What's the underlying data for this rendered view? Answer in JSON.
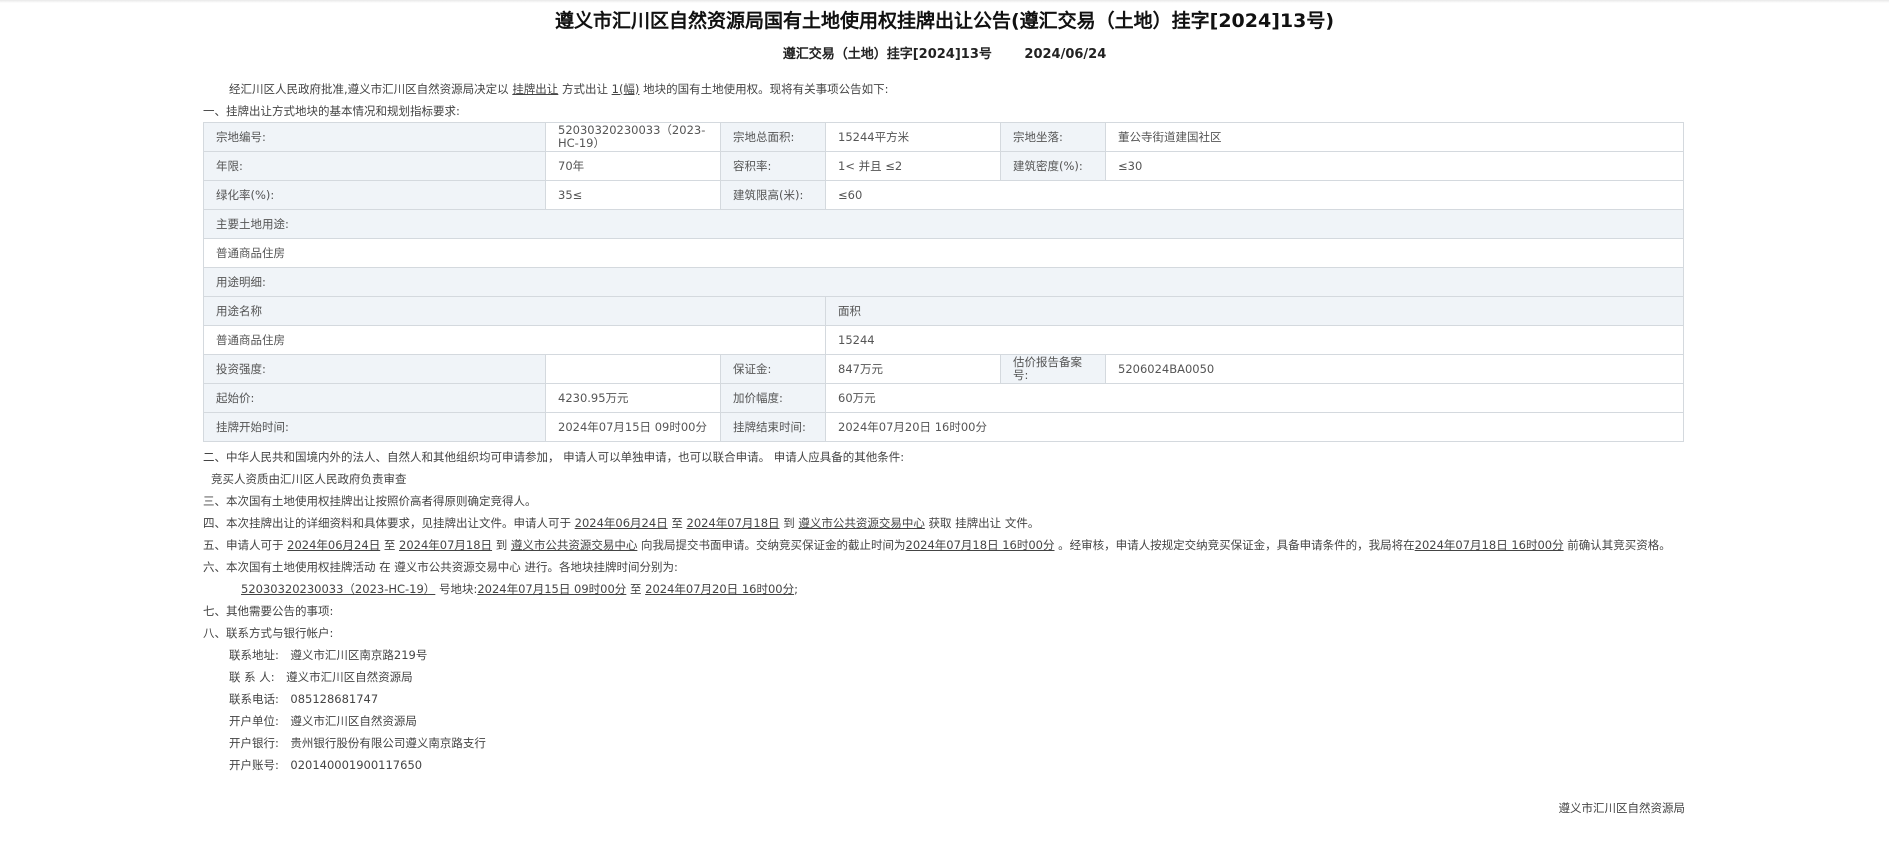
{
  "header": {
    "title": "遵义市汇川区自然资源局国有土地使用权挂牌出让公告(遵汇交易（土地）挂字[2024]13号)",
    "doc_no": "遵汇交易（土地）挂字[2024]13号",
    "date": "2024/06/24"
  },
  "intro": {
    "prefix": "经汇川区人民政府批准,遵义市汇川区自然资源局决定以",
    "method": "挂牌出让",
    "mid": "方式出让",
    "count": "1(幅)",
    "suffix": "地块的国有土地使用权。现将有关事项公告如下:"
  },
  "section1": "一、挂牌出让方式地块的基本情况和规划指标要求:",
  "table": {
    "parcel_no_label": "宗地编号:",
    "parcel_no": "52030320230033（2023-HC-19）",
    "area_label": "宗地总面积:",
    "area": "15244平方米",
    "location_label": "宗地坐落:",
    "location": "董公寺街道建国社区",
    "term_label": "年限:",
    "term": "70年",
    "far_label": "容积率:",
    "far": "1< 并且 ≤2",
    "density_label": "建筑密度(%):",
    "density": "≤30",
    "green_label": "绿化率(%):",
    "green": "35≤",
    "height_label": "建筑限高(米):",
    "height": "≤60",
    "main_use_label": "主要土地用途:",
    "main_use": "普通商品住房",
    "use_detail_label": "用途明细:",
    "use_name_header": "用途名称",
    "use_area_header": "面积",
    "use_name": "普通商品住房",
    "use_area": "15244",
    "invest_label": "投资强度:",
    "invest": "",
    "deposit_label": "保证金:",
    "deposit": "847万元",
    "appraisal_label": "估价报告备案号:",
    "appraisal": "5206024BA0050",
    "start_price_label": "起始价:",
    "start_price": "4230.95万元",
    "increment_label": "加价幅度:",
    "increment": "60万元",
    "listing_start_label": "挂牌开始时间:",
    "listing_start": "2024年07月15日 09时00分",
    "listing_end_label": "挂牌结束时间:",
    "listing_end": "2024年07月20日 16时00分"
  },
  "section2": "二、中华人民共和国境内外的法人、自然人和其他组织均可申请参加， 申请人可以单独申请，也可以联合申请。 申请人应具备的其他条件:",
  "section2_sub": "竞买人资质由汇川区人民政府负责审查",
  "section3": "三、本次国有土地使用权挂牌出让按照价高者得原则确定竞得人。",
  "section4": {
    "p1": "四、本次挂牌出让的详细资料和具体要求，见挂牌出让文件。申请人可于",
    "d1": "2024年06月24日",
    "p2": "至",
    "d2": "2024年07月18日",
    "p3": "到",
    "place": "遵义市公共资源交易中心",
    "p4": "获取 挂牌出让 文件。"
  },
  "section5": {
    "p1": "五、申请人可于",
    "d1": "2024年06月24日",
    "p2": "至",
    "d2": "2024年07月18日",
    "p3": "到",
    "place": "遵义市公共资源交易中心",
    "p4": "向我局提交书面申请。交纳竞买保证金的截止时间为",
    "d3": "2024年07月18日 16时00分",
    "p5": "。经审核，申请人按规定交纳竞买保证金，具备申请条件的，我局将在",
    "d4": "2024年07月18日 16时00分",
    "p6": "前确认其竞买资格。"
  },
  "section6": {
    "line": "六、本次国有土地使用权挂牌活动 在 遵义市公共资源交易中心 进行。各地块挂牌时间分别为:",
    "parcel": "52030320230033（2023-HC-19）",
    "p1": "号地块:",
    "d1": "2024年07月15日 09时00分",
    "p2": "至",
    "d2": "2024年07月20日 16时00分",
    "p3": ";"
  },
  "section7": "七、其他需要公告的事项:",
  "section8": "八、联系方式与银行帐户:",
  "contact": {
    "address": "联系地址:　遵义市汇川区南京路219号",
    "person": "联 系 人:　遵义市汇川区自然资源局",
    "phone": "联系电话:　085128681747",
    "account_unit": "开户单位:　遵义市汇川区自然资源局",
    "bank": "开户银行:　贵州银行股份有限公司遵义南京路支行",
    "account_no": "开户账号:　0201400019001176​50"
  },
  "signature": "遵义市汇川区自然资源局"
}
